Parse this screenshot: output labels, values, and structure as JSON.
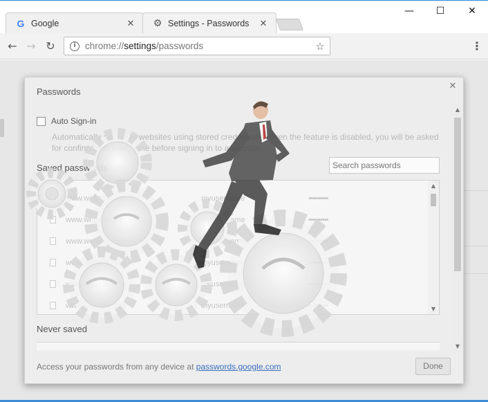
{
  "tabs": [
    {
      "title": "Google",
      "icon": "google-g-icon",
      "active": false
    },
    {
      "title": "Settings - Passwords",
      "icon": "gear-icon",
      "active": true
    }
  ],
  "window_controls": {
    "minimize": "—",
    "maximize": "☐",
    "close": "✕"
  },
  "toolbar": {
    "url_prefix": "chrome://",
    "url_host": "settings",
    "url_path": "/passwords"
  },
  "dialog": {
    "title": "Passwords",
    "auto_signin_label": "Auto Sign-in",
    "auto_signin_description": "Automatically sign in to websites using stored credentials. When the feature is disabled, you will be asked for confirmation every time before signing in to a website.",
    "saved_passwords_title": "Saved passwords",
    "search_placeholder": "Search passwords",
    "saved_passwords": [
      {
        "site": "www.website.com",
        "user": "myusername",
        "password": "••••••••••"
      },
      {
        "site": "www.website.com",
        "user": "myusername",
        "password": "••••••••••"
      },
      {
        "site": "www.website.com",
        "user": "myusername",
        "password": "••••••••••"
      },
      {
        "site": "www.website.com",
        "user": "myusername",
        "password": "••••••••••"
      },
      {
        "site": "www.website.com",
        "user": "myusername",
        "password": "••••••••••"
      },
      {
        "site": "www.website.com",
        "user": "myusername",
        "password": "••••••••••"
      }
    ],
    "never_saved_title": "Never saved",
    "footer_text": "Access your passwords from any device at ",
    "footer_link": "passwords.google.com",
    "done_label": "Done"
  },
  "colors": {
    "accent_blue": "#2b88d8",
    "link": "#3a6dbd",
    "google_blue": "#4285f4"
  }
}
